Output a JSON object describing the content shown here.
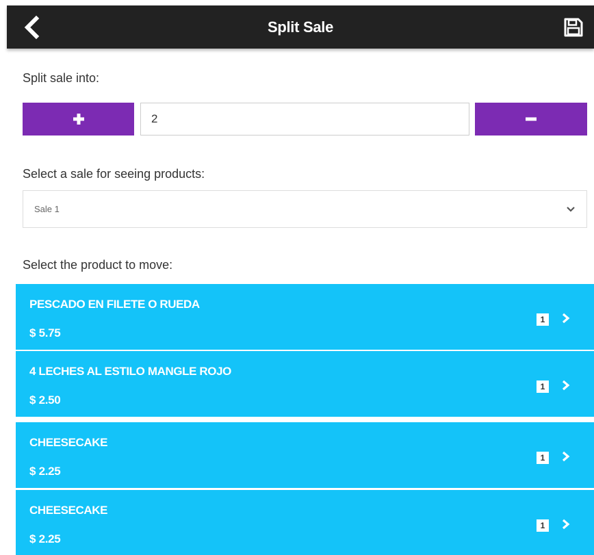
{
  "header": {
    "title": "Split Sale",
    "back_icon": "chevron-left-icon",
    "save_icon": "floppy-disk-icon"
  },
  "split": {
    "label": "Split sale into:",
    "value": "2",
    "plus_icon": "plus-icon",
    "minus_icon": "minus-icon"
  },
  "sale_select": {
    "label": "Select a sale for seeing products:",
    "selected": "Sale 1",
    "icon": "chevron-down-icon"
  },
  "products": {
    "label": "Select the product to move:",
    "items": [
      {
        "name": "PESCADO EN FILETE O RUEDA",
        "price": "$ 5.75",
        "qty": "1"
      },
      {
        "name": "4 LECHES AL ESTILO MANGLE ROJO",
        "price": "$ 2.50",
        "qty": "1"
      },
      {
        "name": "CHEESECAKE",
        "price": "$ 2.25",
        "qty": "1"
      },
      {
        "name": "CHEESECAKE",
        "price": "$ 2.25",
        "qty": "1"
      }
    ]
  },
  "colors": {
    "header_bg": "#222222",
    "accent_purple": "#7c2bb3",
    "product_bg": "#14c3f9"
  }
}
